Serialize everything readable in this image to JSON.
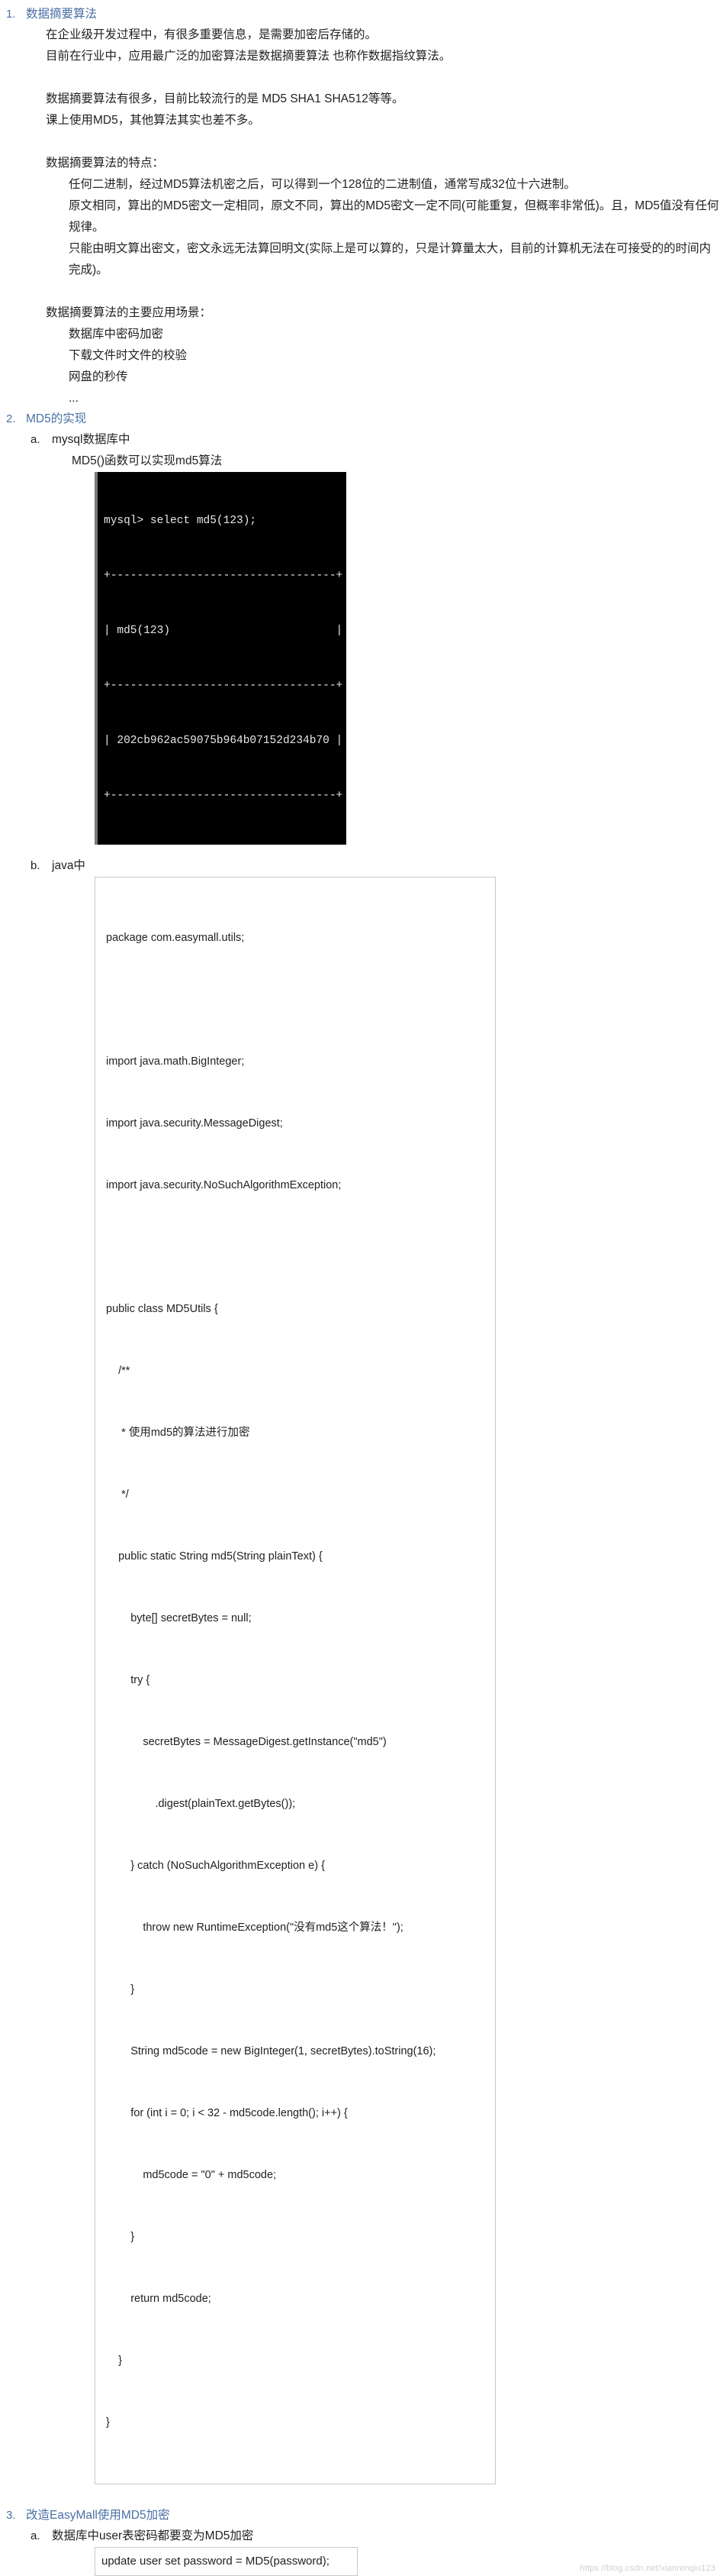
{
  "document": {
    "sections": [
      {
        "number": "1.",
        "title": "数据摘要算法",
        "paragraphs": [
          "在企业级开发过程中，有很多重要信息，是需要加密后存储的。",
          "目前在行业中，应用最广泛的加密算法是数据摘要算法 也称作数据指纹算法。",
          "数据摘要算法有很多，目前比较流行的是 MD5 SHA1 SHA512等等。",
          "课上使用MD5，其他算法其实也差不多。"
        ],
        "features_heading": "数据摘要算法的特点：",
        "features": [
          "任何二进制，经过MD5算法机密之后，可以得到一个128位的二进制值，通常写成32位十六进制。",
          "原文相同，算出的MD5密文一定相同，原文不同，算出的MD5密文一定不同(可能重复，但概率非常低)。且，MD5值没有任何规律。",
          "只能由明文算出密文，密文永远无法算回明文(实际上是可以算的，只是计算量太大，目前的计算机无法在可接受的的时间内完成)。"
        ],
        "scenarios_heading": "数据摘要算法的主要应用场景：",
        "scenarios": [
          "数据库中密码加密",
          "下载文件时文件的校验",
          "网盘的秒传",
          "..."
        ]
      },
      {
        "number": "2.",
        "title": "MD5的实现",
        "sub": [
          {
            "marker": "a.",
            "title": "mysql数据库中",
            "note": "MD5()函数可以实现md5算法",
            "terminal_lines": [
              "mysql> select md5(123);",
              "+----------------------------------+",
              "| md5(123)                         |",
              "+----------------------------------+",
              "| 202cb962ac59075b964b07152d234b70 |",
              "+----------------------------------+"
            ]
          },
          {
            "marker": "b.",
            "title": "java中",
            "code_lines": [
              "package com.easymall.utils;",
              "",
              "import java.math.BigInteger;",
              "import java.security.MessageDigest;",
              "import java.security.NoSuchAlgorithmException;",
              "",
              "public class MD5Utils {",
              "    /**",
              "     * 使用md5的算法进行加密",
              "     */",
              "    public static String md5(String plainText) {",
              "        byte[] secretBytes = null;",
              "        try {",
              "            secretBytes = MessageDigest.getInstance(\"md5\")",
              "                .digest(plainText.getBytes());",
              "        } catch (NoSuchAlgorithmException e) {",
              "            throw new RuntimeException(\"没有md5这个算法！\");",
              "        }",
              "        String md5code = new BigInteger(1, secretBytes).toString(16);",
              "        for (int i = 0; i < 32 - md5code.length(); i++) {",
              "            md5code = \"0\" + md5code;",
              "        }",
              "        return md5code;",
              "    }",
              "}"
            ]
          }
        ]
      },
      {
        "number": "3.",
        "title": "改造EasyMall使用MD5加密",
        "sub": [
          {
            "marker": "a.",
            "title": "数据库中user表密码都要变为MD5加密",
            "sql": "update user set password = MD5(password);"
          }
        ]
      }
    ]
  },
  "watermark": "https://blog.csdn.net/xianrenqiu123",
  "colors": {
    "heading_blue": "#4a6fa5",
    "body_text": "#222222",
    "terminal_bg": "#000000",
    "terminal_text": "#e8e8e8",
    "code_border": "#c8c8c8"
  }
}
